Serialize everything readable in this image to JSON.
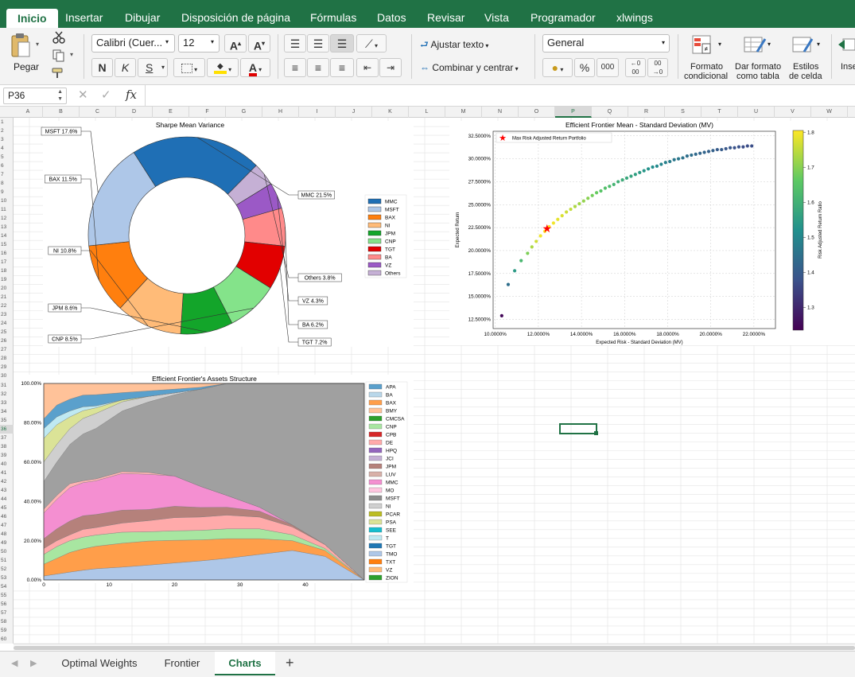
{
  "ribbon_tabs": [
    "Inicio",
    "Insertar",
    "Dibujar",
    "Disposición de página",
    "Fórmulas",
    "Datos",
    "Revisar",
    "Vista",
    "Programador",
    "xlwings"
  ],
  "ribbon": {
    "paste_label": "Pegar",
    "font_name": "Calibri (Cuer...",
    "font_size": "12",
    "bold": "N",
    "italic": "K",
    "underline": "S",
    "wrap_text": "Ajustar texto",
    "merge_center": "Combinar y centrar",
    "number_format": "General",
    "percent": "%",
    "thousands": "000",
    "cond_format_1": "Formato",
    "cond_format_2": "condicional",
    "format_table_1": "Dar formato",
    "format_table_2": "como tabla",
    "cell_styles_1": "Estilos",
    "cell_styles_2": "de celda",
    "insert_cut": "Inse"
  },
  "formula_bar": {
    "name_box": "P36",
    "fx": "fx",
    "value": ""
  },
  "columns": [
    "A",
    "B",
    "C",
    "D",
    "E",
    "F",
    "G",
    "H",
    "I",
    "J",
    "K",
    "L",
    "M",
    "N",
    "O",
    "P",
    "Q",
    "R",
    "S",
    "T",
    "U",
    "V",
    "W"
  ],
  "selected": {
    "column": "P",
    "row": "36"
  },
  "sheet_tabs": [
    "Optimal Weights",
    "Frontier",
    "Charts"
  ],
  "active_sheet": "Charts",
  "chart_data": [
    {
      "type": "pie",
      "title": "Sharpe Mean Variance",
      "slices": [
        {
          "name": "MMC",
          "label": "MMC 21.5%",
          "value": 21.5,
          "color": "#1f6fb5"
        },
        {
          "name": "Others",
          "label": "Others 3.8%",
          "value": 3.8,
          "color": "#c5b0d5"
        },
        {
          "name": "VZ",
          "label": "VZ 4.3%",
          "value": 4.3,
          "color": "#9b59c6"
        },
        {
          "name": "BA",
          "label": "BA 6.2%",
          "value": 6.2,
          "color": "#ff8a8a"
        },
        {
          "name": "TGT",
          "label": "TGT 7.2%",
          "value": 7.2,
          "color": "#e20000"
        },
        {
          "name": "CNP",
          "label": "CNP 8.5%",
          "value": 8.5,
          "color": "#84e38a"
        },
        {
          "name": "JPM",
          "label": "JPM 8.6%",
          "value": 8.6,
          "color": "#13a52a"
        },
        {
          "name": "NI",
          "label": "NI 10.8%",
          "value": 10.8,
          "color": "#ffbb78"
        },
        {
          "name": "BAX",
          "label": "BAX 11.5%",
          "value": 11.5,
          "color": "#ff7f0e"
        },
        {
          "name": "MSFT",
          "label": "MSFT 17.6%",
          "value": 17.6,
          "color": "#aec7e8"
        }
      ],
      "legend": [
        "MMC",
        "MSFT",
        "BAX",
        "NI",
        "JPM",
        "CNP",
        "TGT",
        "BA",
        "VZ",
        "Others"
      ]
    },
    {
      "type": "scatter",
      "title": "Efficient Frontier Mean - Standard Deviation (MV)",
      "xlabel": "Expected Risk - Standard Deviation (MV)",
      "ylabel": "Expected Return",
      "colorbar_label": "Risk Adjusted Return Ratio",
      "colorbar_ticks": [
        "1.8",
        "1.7",
        "1.6",
        "1.5",
        "1.4",
        "1.3"
      ],
      "xticks": [
        "10.0000%",
        "12.0000%",
        "14.0000%",
        "16.0000%",
        "18.0000%",
        "20.0000%",
        "22.0000%"
      ],
      "yticks": [
        "12.5000%",
        "15.0000%",
        "17.5000%",
        "20.0000%",
        "22.5000%",
        "25.0000%",
        "27.5000%",
        "30.0000%",
        "32.5000%"
      ],
      "xlim": [
        9.9,
        23.0
      ],
      "ylim": [
        11.5,
        33.0
      ],
      "legend": "Max Risk Adjusted Return Portfolio",
      "star": {
        "x": 12.4,
        "y": 22.4
      },
      "x": [
        10.3,
        10.6,
        10.9,
        11.2,
        11.5,
        11.7,
        11.9,
        12.1,
        12.3,
        12.5,
        12.7,
        12.9,
        13.1,
        13.3,
        13.5,
        13.7,
        13.9,
        14.1,
        14.3,
        14.5,
        14.7,
        14.9,
        15.1,
        15.3,
        15.5,
        15.7,
        15.9,
        16.1,
        16.3,
        16.5,
        16.7,
        16.9,
        17.1,
        17.3,
        17.5,
        17.7,
        17.9,
        18.1,
        18.3,
        18.5,
        18.7,
        18.9,
        19.1,
        19.3,
        19.5,
        19.7,
        19.9,
        20.1,
        20.3,
        20.5,
        20.7,
        20.9,
        21.1,
        21.3,
        21.5,
        21.7,
        21.9
      ],
      "y": [
        12.9,
        16.3,
        17.8,
        18.9,
        19.7,
        20.4,
        21.0,
        21.6,
        22.1,
        22.6,
        23.0,
        23.4,
        23.8,
        24.2,
        24.5,
        24.8,
        25.1,
        25.4,
        25.7,
        26.0,
        26.3,
        26.5,
        26.8,
        27.0,
        27.2,
        27.5,
        27.7,
        27.9,
        28.1,
        28.3,
        28.5,
        28.7,
        28.9,
        29.1,
        29.2,
        29.4,
        29.6,
        29.7,
        29.9,
        30.0,
        30.1,
        30.3,
        30.4,
        30.5,
        30.6,
        30.7,
        30.8,
        30.9,
        31.0,
        31.0,
        31.1,
        31.2,
        31.2,
        31.3,
        31.3,
        31.4,
        31.4
      ],
      "ratio": [
        1.26,
        1.45,
        1.55,
        1.62,
        1.69,
        1.73,
        1.76,
        1.79,
        1.8,
        1.8,
        1.79,
        1.78,
        1.77,
        1.76,
        1.75,
        1.73,
        1.72,
        1.71,
        1.7,
        1.68,
        1.67,
        1.65,
        1.64,
        1.63,
        1.61,
        1.6,
        1.59,
        1.58,
        1.57,
        1.56,
        1.55,
        1.54,
        1.53,
        1.52,
        1.51,
        1.5,
        1.49,
        1.48,
        1.47,
        1.47,
        1.46,
        1.45,
        1.45,
        1.44,
        1.43,
        1.43,
        1.42,
        1.42,
        1.41,
        1.41,
        1.4,
        1.4,
        1.39,
        1.39,
        1.38,
        1.38,
        1.38
      ]
    },
    {
      "type": "area",
      "title": "Efficient Frontier's Assets Structure",
      "yticks": [
        "0.00%",
        "20.00%",
        "40.00%",
        "60.00%",
        "80.00%",
        "100.00%"
      ],
      "xticks": [
        "0",
        "10",
        "20",
        "30",
        "40"
      ],
      "xlim": [
        0,
        49
      ],
      "ylim": [
        0,
        100
      ],
      "x": [
        0,
        2,
        4,
        6,
        8,
        12,
        16,
        20,
        24,
        28,
        33,
        38,
        43,
        49
      ],
      "series": [
        {
          "name": "TMO",
          "color": "#aec7e8",
          "values": [
            2,
            3,
            4,
            5,
            6,
            7,
            8,
            9,
            10,
            11,
            13,
            15,
            12,
            0
          ]
        },
        {
          "name": "TXT",
          "color": "#ff9e4a",
          "values": [
            6,
            8,
            10,
            11,
            12,
            13,
            13,
            12,
            11,
            10,
            8,
            5,
            3,
            0
          ]
        },
        {
          "name": "CNP",
          "color": "#a8e6a1",
          "values": [
            5,
            6,
            6,
            6,
            6,
            6,
            5,
            5,
            5,
            5,
            5,
            3,
            1,
            0
          ]
        },
        {
          "name": "BA",
          "color": "#ffaaaa",
          "values": [
            3,
            3,
            3,
            4,
            4,
            5,
            6,
            7,
            7,
            7,
            6,
            4,
            2,
            0
          ]
        },
        {
          "name": "JPM",
          "color": "#b5817b",
          "values": [
            5,
            6,
            7,
            7,
            7,
            7,
            6,
            6,
            5,
            4,
            3,
            1,
            0,
            0
          ]
        },
        {
          "name": "MMC",
          "color": "#f48fd1",
          "values": [
            13,
            15,
            17,
            17,
            18,
            20,
            19,
            16,
            11,
            6,
            2,
            0,
            0,
            0
          ]
        },
        {
          "name": "DE",
          "color": "#ffb3b3",
          "values": [
            2,
            2,
            2,
            1,
            1,
            1,
            1,
            0,
            0,
            0,
            0,
            0,
            0,
            0
          ]
        },
        {
          "name": "MSFT",
          "color": "#a0a0a0",
          "values": [
            14,
            17,
            20,
            24,
            27,
            33,
            38,
            43,
            51,
            57,
            63,
            72,
            82,
            100
          ]
        },
        {
          "name": "NI",
          "color": "#cfcfcf",
          "values": [
            10,
            9,
            8,
            8,
            8,
            5,
            3,
            1,
            0,
            0,
            0,
            0,
            0,
            0
          ]
        },
        {
          "name": "PSA",
          "color": "#dbe397",
          "values": [
            12,
            10,
            6,
            4,
            3,
            1,
            0,
            0,
            0,
            0,
            0,
            0,
            0,
            0
          ]
        },
        {
          "name": "T",
          "color": "#bfe9f2",
          "values": [
            5,
            4,
            3,
            2,
            1,
            0,
            0,
            0,
            0,
            0,
            0,
            0,
            0,
            0
          ]
        },
        {
          "name": "TGT",
          "color": "#5aa0cc",
          "values": [
            5,
            6,
            6,
            6,
            6,
            4,
            3,
            2,
            1,
            0,
            0,
            0,
            0,
            0
          ]
        },
        {
          "name": "VZ",
          "color": "#ffc299",
          "values": [
            18,
            11,
            8,
            6,
            6,
            5,
            4,
            3,
            2,
            0,
            0,
            0,
            0,
            0
          ]
        }
      ],
      "legend": [
        {
          "name": "APA",
          "color": "#5aa0cc"
        },
        {
          "name": "BA",
          "color": "#b9d7ea"
        },
        {
          "name": "BAX",
          "color": "#ff9e4a"
        },
        {
          "name": "BMY",
          "color": "#ffc299"
        },
        {
          "name": "CMCSA",
          "color": "#2ca02c"
        },
        {
          "name": "CNP",
          "color": "#a8e6a1"
        },
        {
          "name": "CPB",
          "color": "#d62728"
        },
        {
          "name": "DE",
          "color": "#ffaaaa"
        },
        {
          "name": "HPQ",
          "color": "#9467bd"
        },
        {
          "name": "JCI",
          "color": "#c5b0d5"
        },
        {
          "name": "JPM",
          "color": "#b5817b"
        },
        {
          "name": "LUV",
          "color": "#d8b0a8"
        },
        {
          "name": "MMC",
          "color": "#f48fd1"
        },
        {
          "name": "MO",
          "color": "#ffc6e0"
        },
        {
          "name": "MSFT",
          "color": "#8c8c8c"
        },
        {
          "name": "NI",
          "color": "#cfcfcf"
        },
        {
          "name": "PCAR",
          "color": "#bcbd22"
        },
        {
          "name": "PSA",
          "color": "#dbe397"
        },
        {
          "name": "SEE",
          "color": "#17becf"
        },
        {
          "name": "T",
          "color": "#bfe9f2"
        },
        {
          "name": "TGT",
          "color": "#1f77b4"
        },
        {
          "name": "TMO",
          "color": "#aec7e8"
        },
        {
          "name": "TXT",
          "color": "#ff7f0e"
        },
        {
          "name": "VZ",
          "color": "#ffbb78"
        },
        {
          "name": "ZION",
          "color": "#2ca02c"
        }
      ]
    }
  ]
}
